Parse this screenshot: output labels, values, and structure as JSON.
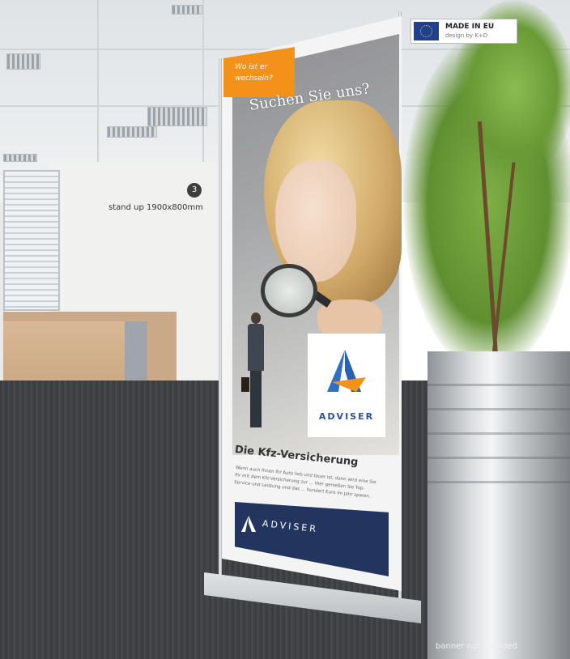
{
  "badge": {
    "title": "MADE IN EU",
    "subtitle": "design by K+D",
    "flag_color": "#1f3f8f"
  },
  "item": {
    "number": "3",
    "caption": "stand up 1900x800mm"
  },
  "banner": {
    "tab_line1": "Wo ist er",
    "tab_line2": "wechseln?",
    "headline": "Suchen Sie uns?",
    "logo_text": "ADVISER",
    "section_title": "Die Kfz-Versicherung",
    "body_text": "Wenn auch Ihnen Ihr Auto lieb und teuer ist, dann wird eine Sie Ihr mit dem Kfz-Versicherung zur ... Hier genießen Sie Top-Service und Leistung und das ... hundert Euro im Jahr sparen.",
    "footer_logo": "ADVISER",
    "accent_color": "#f39219",
    "brand_color": "#23355e"
  },
  "footnote": "banner not included"
}
